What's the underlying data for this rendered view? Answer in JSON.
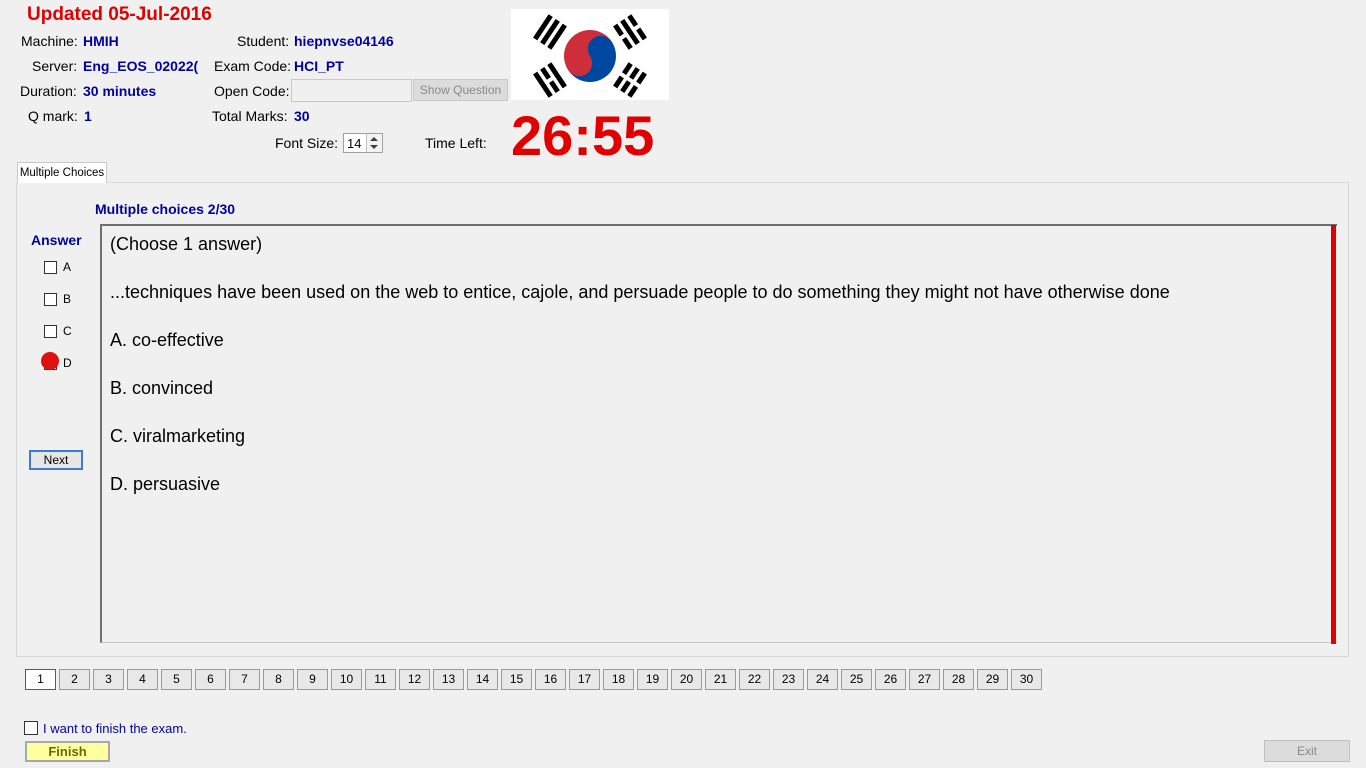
{
  "header": {
    "updated": "Updated 05-Jul-2016",
    "machine_label": "Machine:",
    "machine_value": "HMIH",
    "student_label": "Student:",
    "student_value": "hiepnvse04146",
    "server_label": "Server:",
    "server_value": "Eng_EOS_02022(",
    "exam_code_label": "Exam Code:",
    "exam_code_value": "HCI_PT",
    "duration_label": "Duration:",
    "duration_value": "30 minutes",
    "open_code_label": "Open Code:",
    "open_code_value": "",
    "show_question_label": "Show Question",
    "qmark_label": "Q mark:",
    "qmark_value": "1",
    "total_marks_label": "Total Marks:",
    "total_marks_value": "30",
    "font_size_label": "Font Size:",
    "font_size_value": "14",
    "time_left_label": "Time Left:",
    "time_left_value": "26:55",
    "flag_icon": "south-korea-flag-icon"
  },
  "tab": {
    "label": "Multiple Choices"
  },
  "question": {
    "header": "Multiple choices 2/30",
    "lines": [
      "(Choose 1 answer)",
      "...techniques have been used on the web to entice, cajole, and persuade people to do something they might not have otherwise done",
      "A.  co-effective",
      "B.  convinced",
      "C.  viralmarketing",
      "D.  persuasive"
    ]
  },
  "answer": {
    "label": "Answer",
    "options": [
      "A",
      "B",
      "C",
      "D"
    ],
    "marked": "D",
    "marker_color": "#e01010"
  },
  "next_label": "Next",
  "pages": [
    "1",
    "2",
    "3",
    "4",
    "5",
    "6",
    "7",
    "8",
    "9",
    "10",
    "11",
    "12",
    "13",
    "14",
    "15",
    "16",
    "17",
    "18",
    "19",
    "20",
    "21",
    "22",
    "23",
    "24",
    "25",
    "26",
    "27",
    "28",
    "29",
    "30"
  ],
  "active_page": "1",
  "footer": {
    "finish_checkbox_label": "I want to finish the exam.",
    "finish_label": "Finish",
    "exit_label": "Exit"
  },
  "colors": {
    "accent_red": "#e00000",
    "value_blue": "#0000a0"
  }
}
